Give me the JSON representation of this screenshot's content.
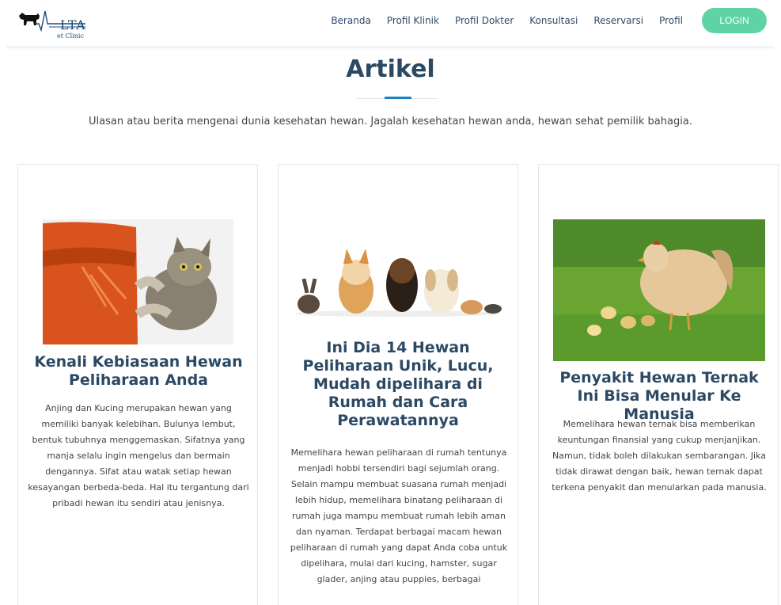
{
  "brand": {
    "logo_text": "LTA",
    "logo_sub": "et Clinic"
  },
  "nav": {
    "items": [
      "Beranda",
      "Profil Klinik",
      "Profil Dokter",
      "Konsultasi",
      "Reservarsi",
      "Profil"
    ],
    "login_label": "LOGIN"
  },
  "colors": {
    "accent": "#5fd3a4",
    "title": "#2c4964",
    "underline": "#1f80c6"
  },
  "section": {
    "title": "Artikel",
    "description": "Ulasan atau berita mengenai dunia kesehatan hewan. Jagalah kesehatan hewan anda, hewan sehat pemilik bahagia."
  },
  "articles": [
    {
      "image": "cat-scratching-sofa-image",
      "title": "Kenali Kebiasaan Hewan Peliharaan Anda",
      "text": "Anjing dan Kucing merupakan hewan yang memiliki banyak kelebihan. Bulunya lembut, bentuk tubuhnya menggemaskan. Sifatnya yang manja selalu ingin mengelus dan bermain dengannya. Sifat atau watak setiap hewan kesayangan berbeda-beda. Hal itu tergantung dari pribadi hewan itu sendiri atau jenisnya."
    },
    {
      "image": "pets-group-image",
      "title": "Ini Dia 14 Hewan Peliharaan Unik, Lucu, Mudah dipelihara di Rumah dan Cara Perawatannya",
      "text": "Memelihara hewan peliharaan di rumah tentunya menjadi hobbi tersendiri bagi sejumlah orang. Selain mampu membuat suasana rumah menjadi lebih hidup, memelihara binatang peliharaan di rumah juga mampu membuat rumah lebih aman dan nyaman. Terdapat berbagai macam hewan peliharaan di rumah yang dapat Anda coba untuk dipelihara, mulai dari kucing, hamster, sugar glader, anjing atau puppies, berbagai"
    },
    {
      "image": "hen-with-chicks-image",
      "title": "Penyakit Hewan Ternak Ini Bisa Menular Ke Manusia",
      "text": "Memelihara hewan ternak bisa memberikan keuntungan finansial yang cukup menjanjikan. Namun, tidak boleh dilakukan sembarangan. Jika tidak dirawat dengan baik, hewan ternak dapat terkena penyakit dan menularkan pada manusia."
    }
  ]
}
